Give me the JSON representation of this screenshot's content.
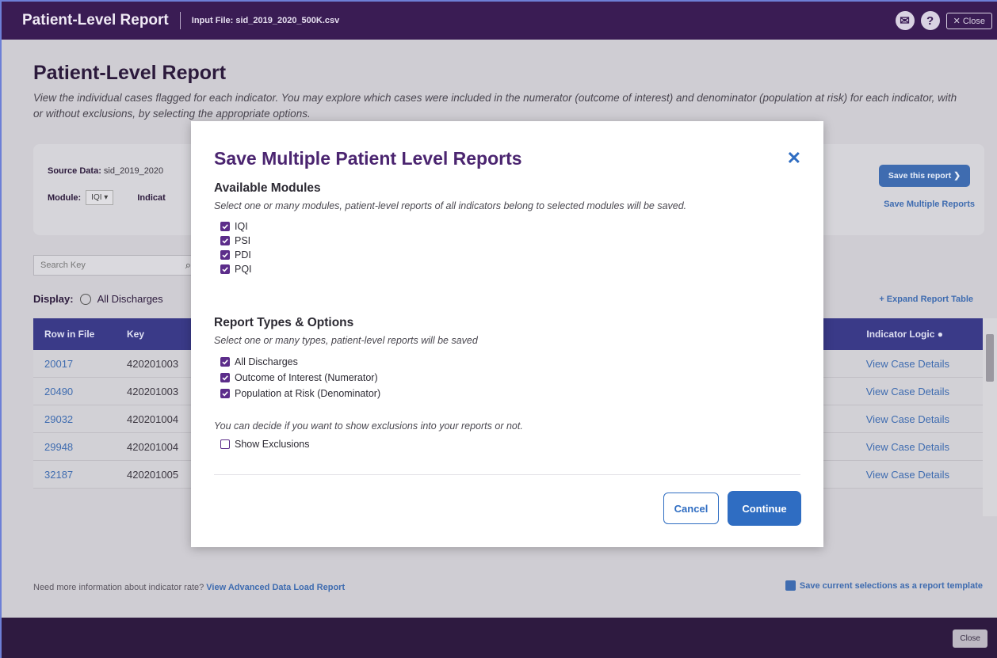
{
  "topbar": {
    "title": "Patient-Level Report",
    "input_file": "Input File: sid_2019_2020_500K.csv",
    "close_label": "✕ Close"
  },
  "page": {
    "title": "Patient-Level Report",
    "description": "View the individual cases flagged for each indicator. You may explore which cases were included in the numerator (outcome of interest) and denominator (population at risk) for each indicator, with or without exclusions, by selecting the appropriate options."
  },
  "filters": {
    "source_label": "Source Data:",
    "source_value": "sid_2019_2020",
    "module_label": "Module:",
    "module_value": "IQI",
    "indicator_label": "Indicat",
    "save_report": "Save this report  ❯",
    "save_multiple": "Save Multiple Reports"
  },
  "search": {
    "placeholder": "Search Key"
  },
  "display": {
    "label": "Display:",
    "option": "All Discharges"
  },
  "expand_link": "+ Expand Report Table",
  "table": {
    "headers": {
      "row": "Row in File",
      "key": "Key",
      "logic": "Indicator Logic"
    },
    "rows": [
      {
        "row": "20017",
        "key": "420201003",
        "action": "View Case Details"
      },
      {
        "row": "20490",
        "key": "420201003",
        "action": "View Case Details"
      },
      {
        "row": "29032",
        "key": "420201004",
        "action": "View Case Details"
      },
      {
        "row": "29948",
        "key": "420201004",
        "action": "View Case Details"
      },
      {
        "row": "32187",
        "key": "420201005",
        "action": "View Case Details"
      }
    ]
  },
  "bottom": {
    "info": "Need more information about indicator rate?",
    "info_link": "View Advanced Data Load Report",
    "template": "Save current selections as a report template"
  },
  "footer": {
    "close": "Close"
  },
  "modal": {
    "title": "Save Multiple Patient Level Reports",
    "modules_title": "Available Modules",
    "modules_desc": "Select one or many modules, patient-level reports of all indicators belong to selected modules will be saved.",
    "modules": [
      "IQI",
      "PSI",
      "PDI",
      "PQI"
    ],
    "types_title": "Report Types & Options",
    "types_desc": "Select one or many types, patient-level reports will be saved",
    "types": [
      "All Discharges",
      "Outcome of Interest (Numerator)",
      "Population at Risk (Denominator)"
    ],
    "exclusions_desc": "You can decide if you want to show exclusions into your reports or not.",
    "exclusions_label": "Show Exclusions",
    "cancel": "Cancel",
    "continue": "Continue"
  }
}
